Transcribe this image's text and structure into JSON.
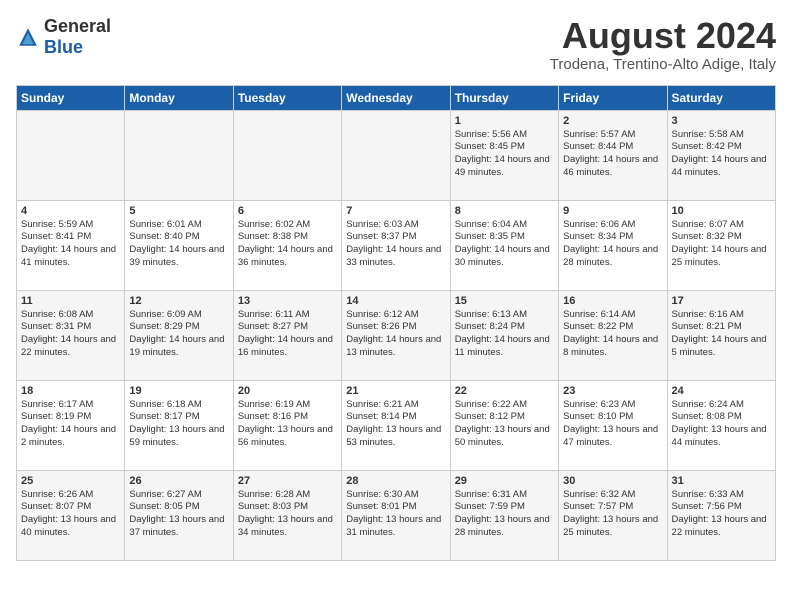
{
  "header": {
    "logo_general": "General",
    "logo_blue": "Blue",
    "month": "August 2024",
    "location": "Trodena, Trentino-Alto Adige, Italy"
  },
  "weekdays": [
    "Sunday",
    "Monday",
    "Tuesday",
    "Wednesday",
    "Thursday",
    "Friday",
    "Saturday"
  ],
  "weeks": [
    [
      {
        "day": "",
        "info": ""
      },
      {
        "day": "",
        "info": ""
      },
      {
        "day": "",
        "info": ""
      },
      {
        "day": "",
        "info": ""
      },
      {
        "day": "1",
        "info": "Sunrise: 5:56 AM\nSunset: 8:45 PM\nDaylight: 14 hours and 49 minutes."
      },
      {
        "day": "2",
        "info": "Sunrise: 5:57 AM\nSunset: 8:44 PM\nDaylight: 14 hours and 46 minutes."
      },
      {
        "day": "3",
        "info": "Sunrise: 5:58 AM\nSunset: 8:42 PM\nDaylight: 14 hours and 44 minutes."
      }
    ],
    [
      {
        "day": "4",
        "info": "Sunrise: 5:59 AM\nSunset: 8:41 PM\nDaylight: 14 hours and 41 minutes."
      },
      {
        "day": "5",
        "info": "Sunrise: 6:01 AM\nSunset: 8:40 PM\nDaylight: 14 hours and 39 minutes."
      },
      {
        "day": "6",
        "info": "Sunrise: 6:02 AM\nSunset: 8:38 PM\nDaylight: 14 hours and 36 minutes."
      },
      {
        "day": "7",
        "info": "Sunrise: 6:03 AM\nSunset: 8:37 PM\nDaylight: 14 hours and 33 minutes."
      },
      {
        "day": "8",
        "info": "Sunrise: 6:04 AM\nSunset: 8:35 PM\nDaylight: 14 hours and 30 minutes."
      },
      {
        "day": "9",
        "info": "Sunrise: 6:06 AM\nSunset: 8:34 PM\nDaylight: 14 hours and 28 minutes."
      },
      {
        "day": "10",
        "info": "Sunrise: 6:07 AM\nSunset: 8:32 PM\nDaylight: 14 hours and 25 minutes."
      }
    ],
    [
      {
        "day": "11",
        "info": "Sunrise: 6:08 AM\nSunset: 8:31 PM\nDaylight: 14 hours and 22 minutes."
      },
      {
        "day": "12",
        "info": "Sunrise: 6:09 AM\nSunset: 8:29 PM\nDaylight: 14 hours and 19 minutes."
      },
      {
        "day": "13",
        "info": "Sunrise: 6:11 AM\nSunset: 8:27 PM\nDaylight: 14 hours and 16 minutes."
      },
      {
        "day": "14",
        "info": "Sunrise: 6:12 AM\nSunset: 8:26 PM\nDaylight: 14 hours and 13 minutes."
      },
      {
        "day": "15",
        "info": "Sunrise: 6:13 AM\nSunset: 8:24 PM\nDaylight: 14 hours and 11 minutes."
      },
      {
        "day": "16",
        "info": "Sunrise: 6:14 AM\nSunset: 8:22 PM\nDaylight: 14 hours and 8 minutes."
      },
      {
        "day": "17",
        "info": "Sunrise: 6:16 AM\nSunset: 8:21 PM\nDaylight: 14 hours and 5 minutes."
      }
    ],
    [
      {
        "day": "18",
        "info": "Sunrise: 6:17 AM\nSunset: 8:19 PM\nDaylight: 14 hours and 2 minutes."
      },
      {
        "day": "19",
        "info": "Sunrise: 6:18 AM\nSunset: 8:17 PM\nDaylight: 13 hours and 59 minutes."
      },
      {
        "day": "20",
        "info": "Sunrise: 6:19 AM\nSunset: 8:16 PM\nDaylight: 13 hours and 56 minutes."
      },
      {
        "day": "21",
        "info": "Sunrise: 6:21 AM\nSunset: 8:14 PM\nDaylight: 13 hours and 53 minutes."
      },
      {
        "day": "22",
        "info": "Sunrise: 6:22 AM\nSunset: 8:12 PM\nDaylight: 13 hours and 50 minutes."
      },
      {
        "day": "23",
        "info": "Sunrise: 6:23 AM\nSunset: 8:10 PM\nDaylight: 13 hours and 47 minutes."
      },
      {
        "day": "24",
        "info": "Sunrise: 6:24 AM\nSunset: 8:08 PM\nDaylight: 13 hours and 44 minutes."
      }
    ],
    [
      {
        "day": "25",
        "info": "Sunrise: 6:26 AM\nSunset: 8:07 PM\nDaylight: 13 hours and 40 minutes."
      },
      {
        "day": "26",
        "info": "Sunrise: 6:27 AM\nSunset: 8:05 PM\nDaylight: 13 hours and 37 minutes."
      },
      {
        "day": "27",
        "info": "Sunrise: 6:28 AM\nSunset: 8:03 PM\nDaylight: 13 hours and 34 minutes."
      },
      {
        "day": "28",
        "info": "Sunrise: 6:30 AM\nSunset: 8:01 PM\nDaylight: 13 hours and 31 minutes."
      },
      {
        "day": "29",
        "info": "Sunrise: 6:31 AM\nSunset: 7:59 PM\nDaylight: 13 hours and 28 minutes."
      },
      {
        "day": "30",
        "info": "Sunrise: 6:32 AM\nSunset: 7:57 PM\nDaylight: 13 hours and 25 minutes."
      },
      {
        "day": "31",
        "info": "Sunrise: 6:33 AM\nSunset: 7:56 PM\nDaylight: 13 hours and 22 minutes."
      }
    ]
  ]
}
